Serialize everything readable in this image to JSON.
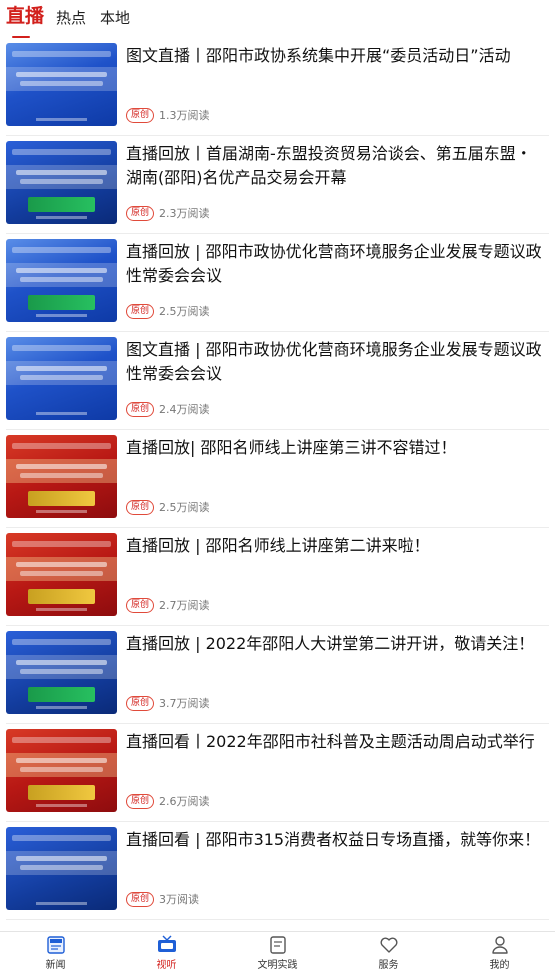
{
  "tabs": [
    {
      "label": "直播",
      "active": true
    },
    {
      "label": "热点",
      "active": false
    },
    {
      "label": "本地",
      "active": false
    }
  ],
  "items": [
    {
      "title": "图文直播丨邵阳市政协系统集中开展“委员活动日”活动",
      "badge": "原创",
      "reads": "1.3万阅读",
      "thumb": "blue"
    },
    {
      "title": "直播回放丨首届湖南-东盟投资贸易洽谈会、第五届东盟・湖南(邵阳)名优产品交易会开幕",
      "badge": "原创",
      "reads": "2.3万阅读",
      "thumb": "navy"
    },
    {
      "title": "直播回放 | 邵阳市政协优化营商环境服务企业发展专题议政性常委会会议",
      "badge": "原创",
      "reads": "2.5万阅读",
      "thumb": "blue"
    },
    {
      "title": "图文直播 | 邵阳市政协优化营商环境服务企业发展专题议政性常委会会议",
      "badge": "原创",
      "reads": "2.4万阅读",
      "thumb": "blue"
    },
    {
      "title": "直播回放| 邵阳名师线上讲座第三讲不容错过！",
      "badge": "原创",
      "reads": "2.5万阅读",
      "thumb": "red"
    },
    {
      "title": "直播回放 | 邵阳名师线上讲座第二讲来啦！",
      "badge": "原创",
      "reads": "2.7万阅读",
      "thumb": "red"
    },
    {
      "title": "直播回放 | 2022年邵阳人大讲堂第二讲开讲，敬请关注！",
      "badge": "原创",
      "reads": "3.7万阅读",
      "thumb": "navy"
    },
    {
      "title": "直播回看丨2022年邵阳市社科普及主题活动周启动式举行",
      "badge": "原创",
      "reads": "2.6万阅读",
      "thumb": "red"
    },
    {
      "title": "直播回看 | 邵阳市315消费者权益日专场直播，就等你来！",
      "badge": "原创",
      "reads": "3万阅读",
      "thumb": "navy"
    }
  ],
  "nav": [
    {
      "label": "新闻",
      "icon": "news-icon",
      "active": false
    },
    {
      "label": "视听",
      "icon": "tv-icon",
      "active": true
    },
    {
      "label": "文明实践",
      "icon": "document-icon",
      "active": false
    },
    {
      "label": "服务",
      "icon": "heart-icon",
      "active": false
    },
    {
      "label": "我的",
      "icon": "user-icon",
      "active": false
    }
  ],
  "colors": {
    "accent": "#d2201c"
  }
}
